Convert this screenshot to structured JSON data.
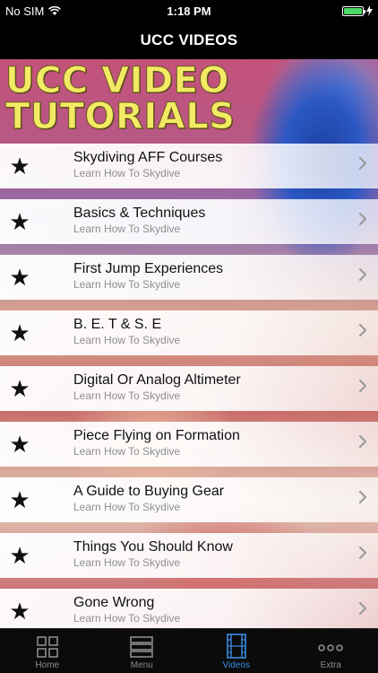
{
  "status_bar": {
    "carrier": "No SIM",
    "time": "1:18 PM",
    "battery_level": 1.0
  },
  "nav": {
    "title": "UCC VIDEOS"
  },
  "hero": {
    "line1": "UCC VIDEO",
    "line2": "TUTORIALS"
  },
  "list": {
    "items": [
      {
        "title": "Skydiving AFF Courses",
        "subtitle": "Learn How To Skydive"
      },
      {
        "title": "Basics & Techniques",
        "subtitle": "Learn How To Skydive"
      },
      {
        "title": "First Jump Experiences",
        "subtitle": "Learn How To Skydive"
      },
      {
        "title": "B. E. T & S. E",
        "subtitle": "Learn How To Skydive"
      },
      {
        "title": "Digital Or Analog Altimeter",
        "subtitle": "Learn How To Skydive"
      },
      {
        "title": "Piece Flying on Formation",
        "subtitle": "Learn How To Skydive"
      },
      {
        "title": "A Guide to Buying Gear",
        "subtitle": "Learn How To Skydive"
      },
      {
        "title": "Things You Should Know",
        "subtitle": "Learn How To Skydive"
      },
      {
        "title": "Gone Wrong",
        "subtitle": "Learn How To Skydive"
      }
    ]
  },
  "tabs": [
    {
      "label": "Home",
      "icon": "grid-icon",
      "active": false
    },
    {
      "label": "Menu",
      "icon": "menu-icon",
      "active": false
    },
    {
      "label": "Videos",
      "icon": "film-icon",
      "active": true
    },
    {
      "label": "Extra",
      "icon": "more-icon",
      "active": false
    }
  ],
  "colors": {
    "active_tab": "#3a8ee6",
    "inactive_tab": "#8c8c8c",
    "hero_text": "#f2ea64"
  }
}
